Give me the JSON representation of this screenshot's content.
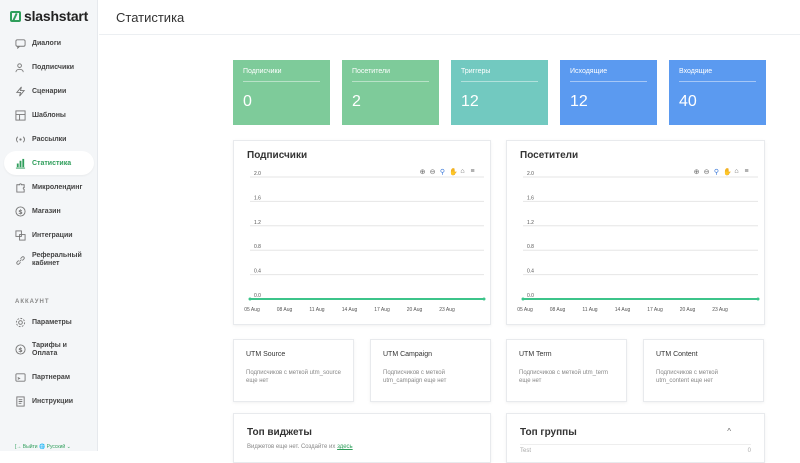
{
  "app": {
    "brand": "slashstart",
    "page_title": "Статистика"
  },
  "sidebar": {
    "items": [
      {
        "label": "Диалоги",
        "icon": "chat-icon"
      },
      {
        "label": "Подписчики",
        "icon": "users-icon"
      },
      {
        "label": "Сценарии",
        "icon": "lightning-icon"
      },
      {
        "label": "Шаблоны",
        "icon": "template-icon"
      },
      {
        "label": "Рассылки",
        "icon": "broadcast-icon"
      },
      {
        "label": "Статистика",
        "icon": "stats-icon",
        "active": true
      },
      {
        "label": "Микролендинг",
        "icon": "puzzle-icon"
      },
      {
        "label": "Магазин",
        "icon": "dollar-icon"
      },
      {
        "label": "Интеграции",
        "icon": "integration-icon"
      },
      {
        "label": "Реферальный кабинет",
        "icon": "link-icon"
      }
    ],
    "section_label": "АККАУНТ",
    "account_items": [
      {
        "label": "Параметры",
        "icon": "gear-icon"
      },
      {
        "label": "Тарифы и Оплата",
        "icon": "dollar-icon"
      },
      {
        "label": "Партнерам",
        "icon": "card-icon"
      },
      {
        "label": "Инструкции",
        "icon": "book-icon"
      }
    ],
    "footer": {
      "logout": "Выйти",
      "language": "Русский"
    }
  },
  "stats": [
    {
      "label": "Подписчики",
      "value": "0",
      "color": "#7ecb9a"
    },
    {
      "label": "Посетители",
      "value": "2",
      "color": "#7ecb9a"
    },
    {
      "label": "Триггеры",
      "value": "12",
      "color": "#72c9c0"
    },
    {
      "label": "Исходящие",
      "value": "12",
      "color": "#5b9af0"
    },
    {
      "label": "Входящие",
      "value": "40",
      "color": "#5b9af0"
    }
  ],
  "charts": {
    "subscribers_title": "Подписчики",
    "visitors_title": "Посетители"
  },
  "chart_data": [
    {
      "type": "line",
      "title": "Подписчики",
      "y_ticks": [
        "2.0",
        "1.6",
        "1.2",
        "0.8",
        "0.4",
        "0.0"
      ],
      "x_ticks": [
        "05 Aug",
        "08 Aug",
        "11 Aug",
        "14 Aug",
        "17 Aug",
        "20 Aug",
        "23 Aug"
      ],
      "ylim": [
        0,
        2
      ],
      "series": [
        {
          "values": [
            0,
            0,
            0,
            0,
            0,
            0,
            0
          ],
          "color": "#3cc48a"
        }
      ]
    },
    {
      "type": "line",
      "title": "Посетители",
      "y_ticks": [
        "2.0",
        "1.6",
        "1.2",
        "0.8",
        "0.4",
        "0.0"
      ],
      "x_ticks": [
        "05 Aug",
        "08 Aug",
        "11 Aug",
        "14 Aug",
        "17 Aug",
        "20 Aug",
        "23 Aug"
      ],
      "ylim": [
        0,
        2
      ],
      "series": [
        {
          "values": [
            0,
            0,
            0,
            0,
            0,
            0,
            0
          ],
          "color": "#3cc48a"
        }
      ]
    }
  ],
  "utm": [
    {
      "title": "UTM Source",
      "desc": "Подписчиков с меткой utm_source еще нет"
    },
    {
      "title": "UTM Campaign",
      "desc": "Подписчиков с меткой utm_campaign еще нет"
    },
    {
      "title": "UTM Term",
      "desc": "Подписчиков с меткой utm_term еще нет"
    },
    {
      "title": "UTM Content",
      "desc": "Подписчиков с меткой utm_content еще нет"
    }
  ],
  "widgets": {
    "title": "Топ виджеты",
    "empty": "Виджетов еще нет. Создайте их",
    "link": "здесь"
  },
  "groups": {
    "title": "Топ группы",
    "row_name": "Test",
    "row_value": "0"
  }
}
